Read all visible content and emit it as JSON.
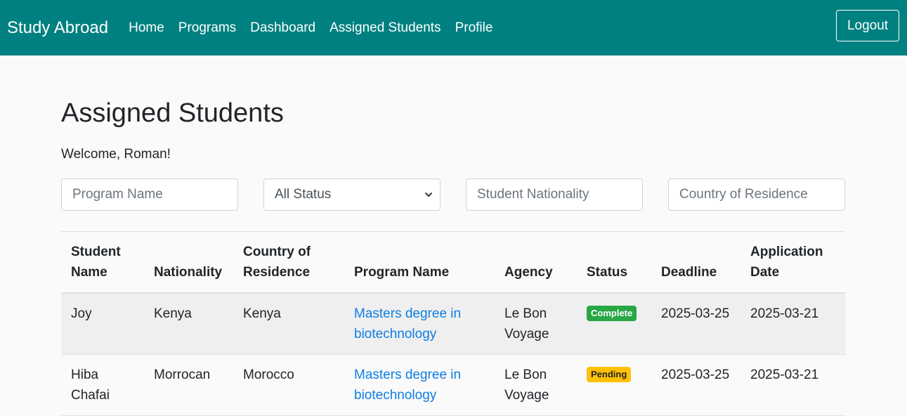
{
  "navbar": {
    "brand": "Study Abroad",
    "links": [
      "Home",
      "Programs",
      "Dashboard",
      "Assigned Students",
      "Profile"
    ],
    "logout": "Logout"
  },
  "page": {
    "title": "Assigned Students",
    "welcome": "Welcome, Roman!"
  },
  "filters": {
    "program_placeholder": "Program Name",
    "status_selected": "All Status",
    "nationality_placeholder": "Student Nationality",
    "residence_placeholder": "Country of Residence"
  },
  "table": {
    "headers": [
      "Student Name",
      "Nationality",
      "Country of Residence",
      "Program Name",
      "Agency",
      "Status",
      "Deadline",
      "Application Date"
    ],
    "rows": [
      {
        "student": "Joy",
        "nationality": "Kenya",
        "residence": "Kenya",
        "program": "Masters degree in biotechnology",
        "agency": "Le Bon Voyage",
        "status": "Complete",
        "deadline": "2025-03-25",
        "application_date": "2025-03-21"
      },
      {
        "student": "Hiba Chafai",
        "nationality": "Morrocan",
        "residence": "Morocco",
        "program": "Masters degree in biotechnology",
        "agency": "Le Bon Voyage",
        "status": "Pending",
        "deadline": "2025-03-25",
        "application_date": "2025-03-21"
      }
    ]
  },
  "colors": {
    "navbar": "#008080",
    "link": "#0d7ee3",
    "complete": "#28a745",
    "pending": "#ffc107"
  }
}
